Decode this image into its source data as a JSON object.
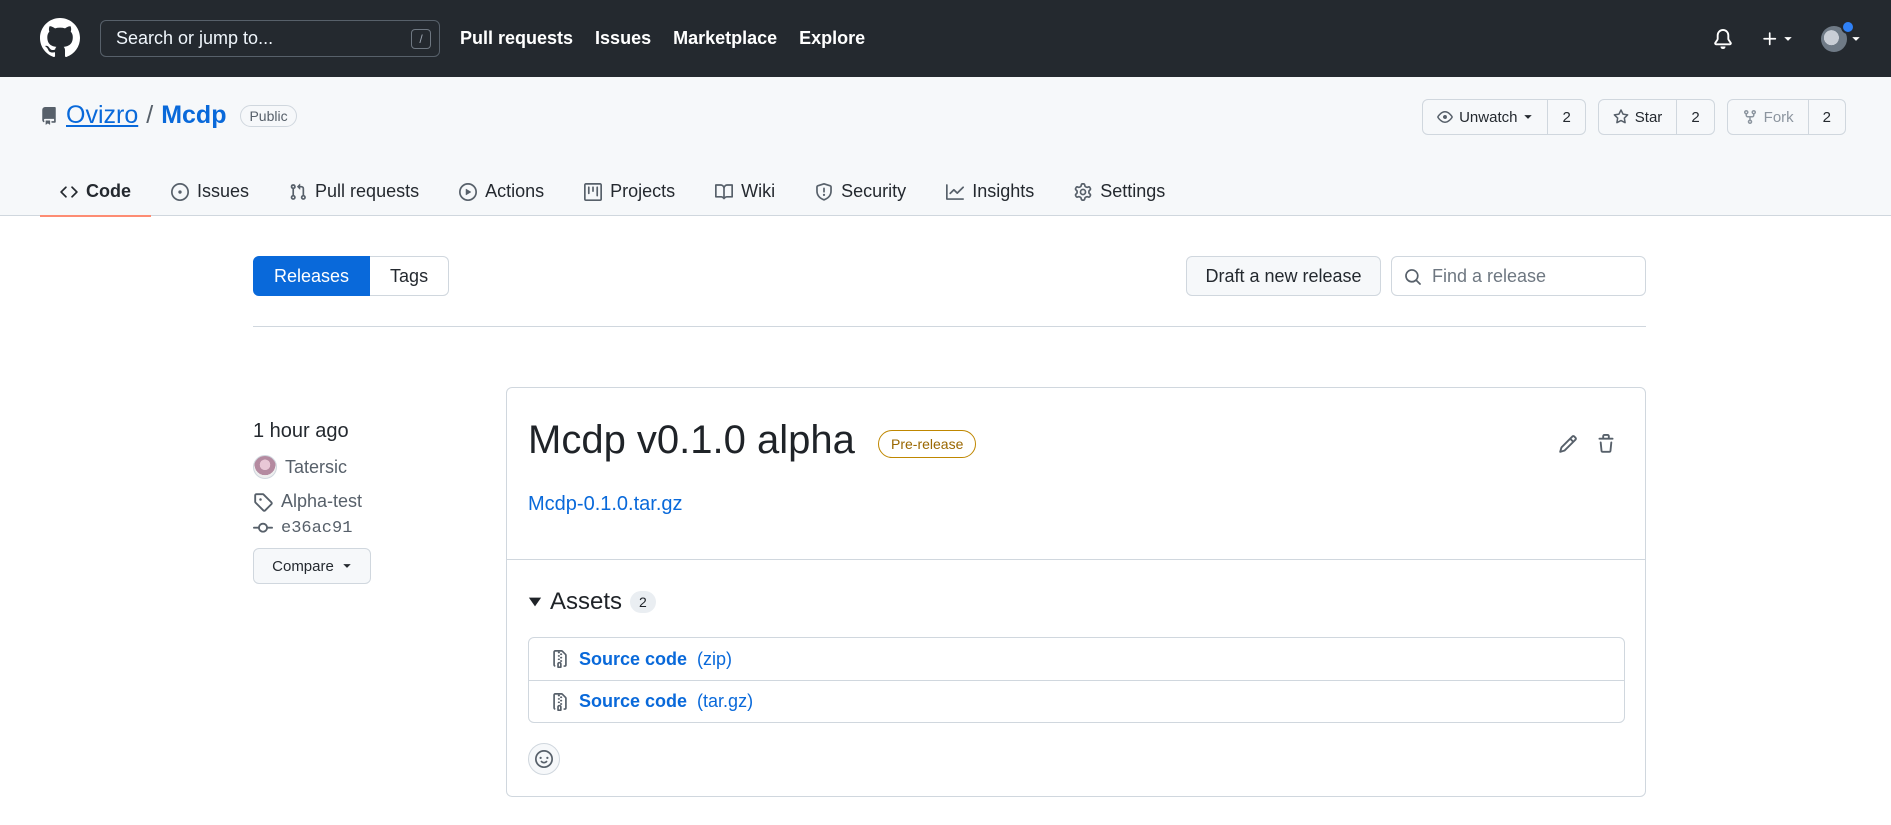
{
  "header": {
    "search_placeholder": "Search or jump to...",
    "search_shortcut": "/",
    "nav": [
      "Pull requests",
      "Issues",
      "Marketplace",
      "Explore"
    ]
  },
  "repo": {
    "owner": "Ovizro",
    "separator": "/",
    "name": "Mcdp",
    "visibility": "Public",
    "watch_label": "Unwatch",
    "watch_count": "2",
    "star_label": "Star",
    "star_count": "2",
    "fork_label": "Fork",
    "fork_count": "2",
    "tabs": [
      "Code",
      "Issues",
      "Pull requests",
      "Actions",
      "Projects",
      "Wiki",
      "Security",
      "Insights",
      "Settings"
    ]
  },
  "releases_page": {
    "releases_tab": "Releases",
    "tags_tab": "Tags",
    "draft_button": "Draft a new release",
    "find_placeholder": "Find a release"
  },
  "release": {
    "time_ago": "1 hour ago",
    "author": "Tatersic",
    "tag": "Alpha-test",
    "commit": "e36ac91",
    "compare_label": "Compare",
    "title": "Mcdp v0.1.0 alpha",
    "badge": "Pre-release",
    "body_link": "Mcdp-0.1.0.tar.gz",
    "assets_label": "Assets",
    "assets_count": "2",
    "assets": [
      {
        "name": "Source code",
        "ext": "(zip)"
      },
      {
        "name": "Source code",
        "ext": "(tar.gz)"
      }
    ]
  },
  "colors": {
    "header_bg": "#24292f",
    "accent": "#0969da",
    "active_tab_underline": "#fd8c73",
    "prerelease": "#9a6700"
  }
}
